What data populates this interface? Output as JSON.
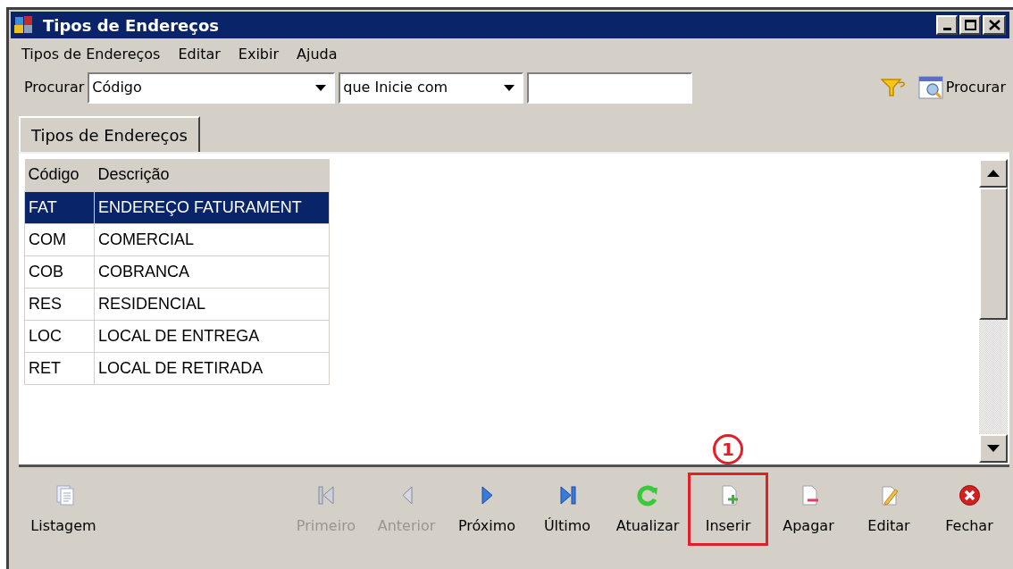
{
  "window": {
    "title": "Tipos de Endereços"
  },
  "menu": [
    "Tipos de Endereços",
    "Editar",
    "Exibir",
    "Ajuda"
  ],
  "search": {
    "label": "Procurar",
    "field": "Código",
    "condition": "que Inicie com",
    "button": "Procurar"
  },
  "tabs": [
    {
      "label": "Tipos de Endereços",
      "selected": true
    }
  ],
  "table": {
    "columns": [
      "Código",
      "Descrição"
    ],
    "rows": [
      {
        "cells": [
          "FAT",
          "ENDEREÇO FATURAMENT"
        ],
        "selected": true
      },
      {
        "cells": [
          "COM",
          "COMERCIAL"
        ],
        "selected": false
      },
      {
        "cells": [
          "COB",
          "COBRANCA"
        ],
        "selected": false
      },
      {
        "cells": [
          "RES",
          "RESIDENCIAL"
        ],
        "selected": false
      },
      {
        "cells": [
          "LOC",
          "LOCAL DE ENTREGA"
        ],
        "selected": false
      },
      {
        "cells": [
          "RET",
          "LOCAL DE RETIRADA"
        ],
        "selected": false
      }
    ]
  },
  "toolbar": [
    {
      "kind": "list",
      "label": "Listagem",
      "disabled": false,
      "highlighted": false
    },
    {
      "kind": "first",
      "label": "Primeiro",
      "disabled": true,
      "highlighted": false
    },
    {
      "kind": "prev",
      "label": "Anterior",
      "disabled": true,
      "highlighted": false
    },
    {
      "kind": "next",
      "label": "Próximo",
      "disabled": false,
      "highlighted": false
    },
    {
      "kind": "last",
      "label": "Último",
      "disabled": false,
      "highlighted": false
    },
    {
      "kind": "refresh",
      "label": "Atualizar",
      "disabled": false,
      "highlighted": false
    },
    {
      "kind": "insert",
      "label": "Inserir",
      "disabled": false,
      "highlighted": true
    },
    {
      "kind": "delete",
      "label": "Apagar",
      "disabled": false,
      "highlighted": false
    },
    {
      "kind": "edit",
      "label": "Editar",
      "disabled": false,
      "highlighted": false
    },
    {
      "kind": "close",
      "label": "Fechar",
      "disabled": false,
      "highlighted": false
    }
  ],
  "annotation": {
    "label": "1"
  }
}
